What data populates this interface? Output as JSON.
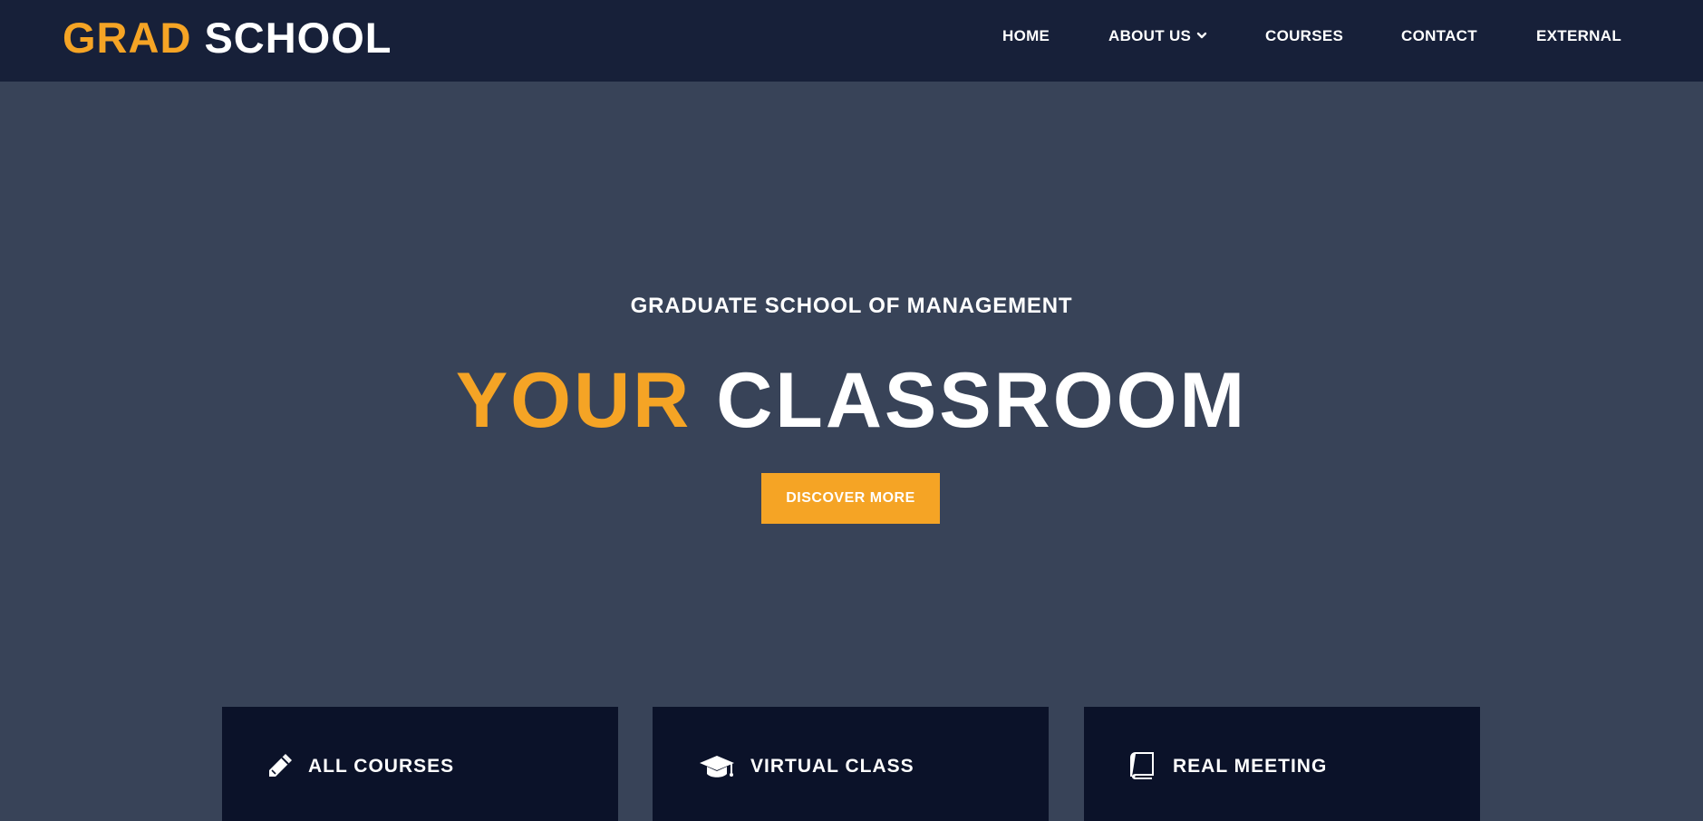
{
  "header": {
    "logo_accent": "GRAD",
    "logo_plain": "SCHOOL",
    "nav": {
      "home": "HOME",
      "about": "ABOUT US",
      "courses": "COURSES",
      "contact": "CONTACT",
      "external": "EXTERNAL"
    }
  },
  "hero": {
    "subtitle": "GRADUATE SCHOOL OF MANAGEMENT",
    "title_accent": "YOUR",
    "title_plain": "CLASSROOM",
    "cta_label": "DISCOVER MORE"
  },
  "features": [
    {
      "label": "ALL COURSES",
      "icon": "pencil-icon"
    },
    {
      "label": "VIRTUAL CLASS",
      "icon": "graduation-cap-icon"
    },
    {
      "label": "REAL MEETING",
      "icon": "book-icon"
    }
  ],
  "colors": {
    "accent": "#f5a425",
    "header_bg": "#172039",
    "hero_bg": "#384358",
    "card_bg": "#0b1229",
    "text": "#ffffff"
  }
}
